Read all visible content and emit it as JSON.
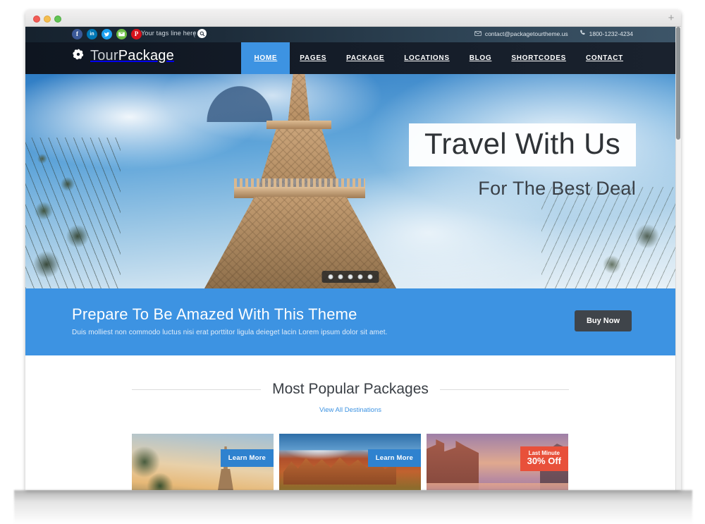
{
  "browser": {
    "traffic_lights": [
      "close",
      "minimize",
      "maximize"
    ],
    "new_tab_label": "+"
  },
  "topbar": {
    "social": [
      {
        "name": "facebook-icon",
        "glyph": "f"
      },
      {
        "name": "linkedin-icon",
        "glyph": "in"
      },
      {
        "name": "twitter-icon",
        "glyph": "t"
      },
      {
        "name": "email-icon",
        "glyph": "✉"
      },
      {
        "name": "pinterest-icon",
        "glyph": "P"
      }
    ],
    "tagline": "Your tags line here",
    "search_bracket": "(",
    "search_icon": "search-icon",
    "email": "contact@packagetourtheme.us",
    "email_icon": "envelope-icon",
    "phone": "1800-1232-4234",
    "phone_icon": "phone-icon"
  },
  "nav": {
    "brand_part1": "Tour",
    "brand_part2": "Package",
    "brand_icon": "shutter-flower-icon",
    "items": [
      {
        "label": "HOME",
        "active": true
      },
      {
        "label": "PAGES",
        "active": false
      },
      {
        "label": "PACKAGE",
        "active": false
      },
      {
        "label": "LOCATIONS",
        "active": false
      },
      {
        "label": "BLOG",
        "active": false
      },
      {
        "label": "SHORTCODES",
        "active": false
      },
      {
        "label": "CONTACT",
        "active": false
      }
    ]
  },
  "hero": {
    "title": "Travel With Us",
    "subtitle": "For The Best Deal",
    "slide_count": 5,
    "active_slide": 1,
    "image_alt": "eiffel-tower-photo"
  },
  "cta": {
    "title": "Prepare To Be Amazed With This Theme",
    "subtitle": "Duis molliest non commodo luctus nisi erat porttitor ligula deieget lacin Lorem ipsum dolor sit amet.",
    "button_label": "Buy Now",
    "background_color": "#3d93e2",
    "button_color": "#3f444a"
  },
  "packages": {
    "section_title": "Most Popular Packages",
    "view_all_label": "View All Destinations",
    "link_color": "#3d93e2",
    "cards": [
      {
        "image_alt": "eiffel-tower-sunset-photo",
        "overlay_type": "button",
        "overlay_label": "Learn More"
      },
      {
        "image_alt": "red-rock-canyon-photo",
        "overlay_type": "button",
        "overlay_label": "Learn More"
      },
      {
        "image_alt": "venice-canal-gondola-photo",
        "overlay_type": "badge",
        "badge_top": "Last Minute",
        "badge_bottom": "30% Off",
        "badge_color": "#e8503a"
      }
    ]
  }
}
